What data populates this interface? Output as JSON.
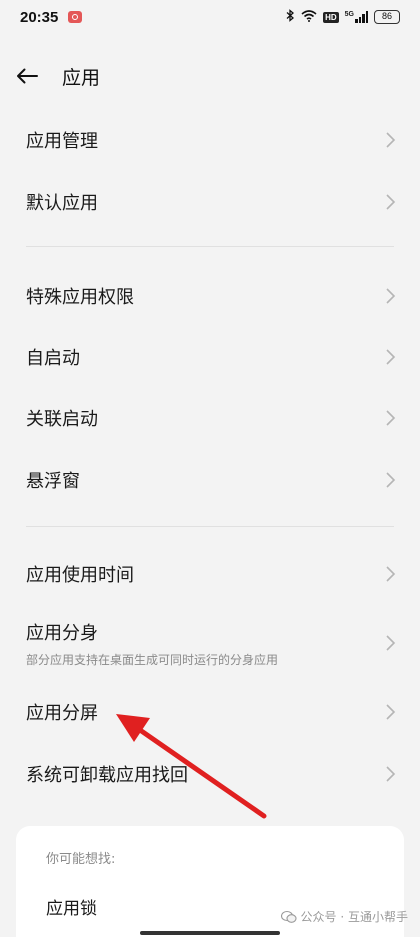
{
  "status_bar": {
    "time": "20:35",
    "network": "5G",
    "hd": "HD",
    "battery": "86"
  },
  "header": {
    "title": "应用"
  },
  "group1": [
    {
      "label": "应用管理"
    },
    {
      "label": "默认应用"
    }
  ],
  "group2": [
    {
      "label": "特殊应用权限"
    },
    {
      "label": "自启动"
    },
    {
      "label": "关联启动"
    },
    {
      "label": "悬浮窗"
    }
  ],
  "group3": [
    {
      "label": "应用使用时间"
    },
    {
      "label": "应用分身",
      "desc": "部分应用支持在桌面生成可同时运行的分身应用"
    },
    {
      "label": "应用分屏"
    },
    {
      "label": "系统可卸载应用找回"
    }
  ],
  "suggestions": {
    "heading": "你可能想找:",
    "items": [
      "应用锁"
    ]
  },
  "watermark": {
    "text": "公众号 · 互通小帮手"
  },
  "colors": {
    "background": "#f3f3f3",
    "card": "#ffffff",
    "arrow": "#e02020",
    "chevron": "#b5b5b5"
  }
}
